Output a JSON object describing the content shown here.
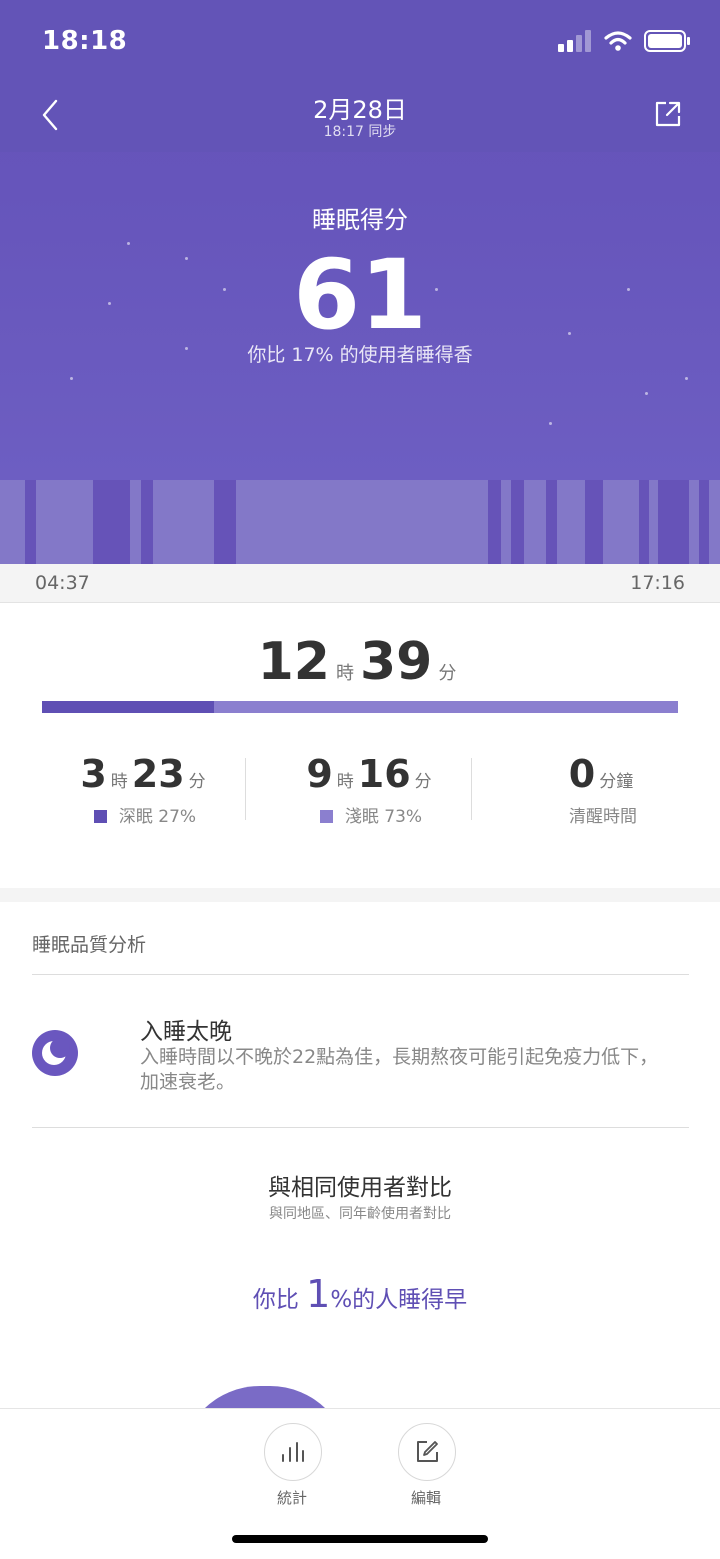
{
  "status": {
    "time": "18:18"
  },
  "nav": {
    "title": "2月28日",
    "sync": "18:17 同步"
  },
  "score": {
    "label": "睡眠得分",
    "value": "61",
    "compare": "你比 17% 的使用者睡得香"
  },
  "timeline": {
    "start": "04:37",
    "end": "17:16"
  },
  "duration": {
    "hours": "12",
    "hours_unit": "時",
    "minutes": "39",
    "minutes_unit": "分",
    "deep_fraction": 0.27
  },
  "stats": {
    "deep": {
      "hours": "3",
      "h_unit": "時",
      "minutes": "23",
      "m_unit": "分",
      "label": "深眠 27%"
    },
    "light": {
      "hours": "9",
      "h_unit": "時",
      "minutes": "16",
      "m_unit": "分",
      "label": "淺眠 73%"
    },
    "awake": {
      "minutes": "0",
      "m_unit": "分鐘",
      "label": "清醒時間"
    }
  },
  "analysis": {
    "section_title": "睡眠品質分析",
    "item_title": "入睡太晚",
    "item_desc": "入睡時間以不晚於22點為佳，長期熬夜可能引起免疫力低下，加速衰老。"
  },
  "comparison": {
    "title": "與相同使用者對比",
    "subtitle": "與同地區、同年齡使用者對比",
    "prefix": "你比 ",
    "number": "1",
    "suffix": "%的人睡得早"
  },
  "tabs": {
    "stats": "統計",
    "edit": "編輯"
  },
  "colors": {
    "deep": "#5f4fb4",
    "light": "#8b7fcf",
    "header": "#6655bb"
  }
}
